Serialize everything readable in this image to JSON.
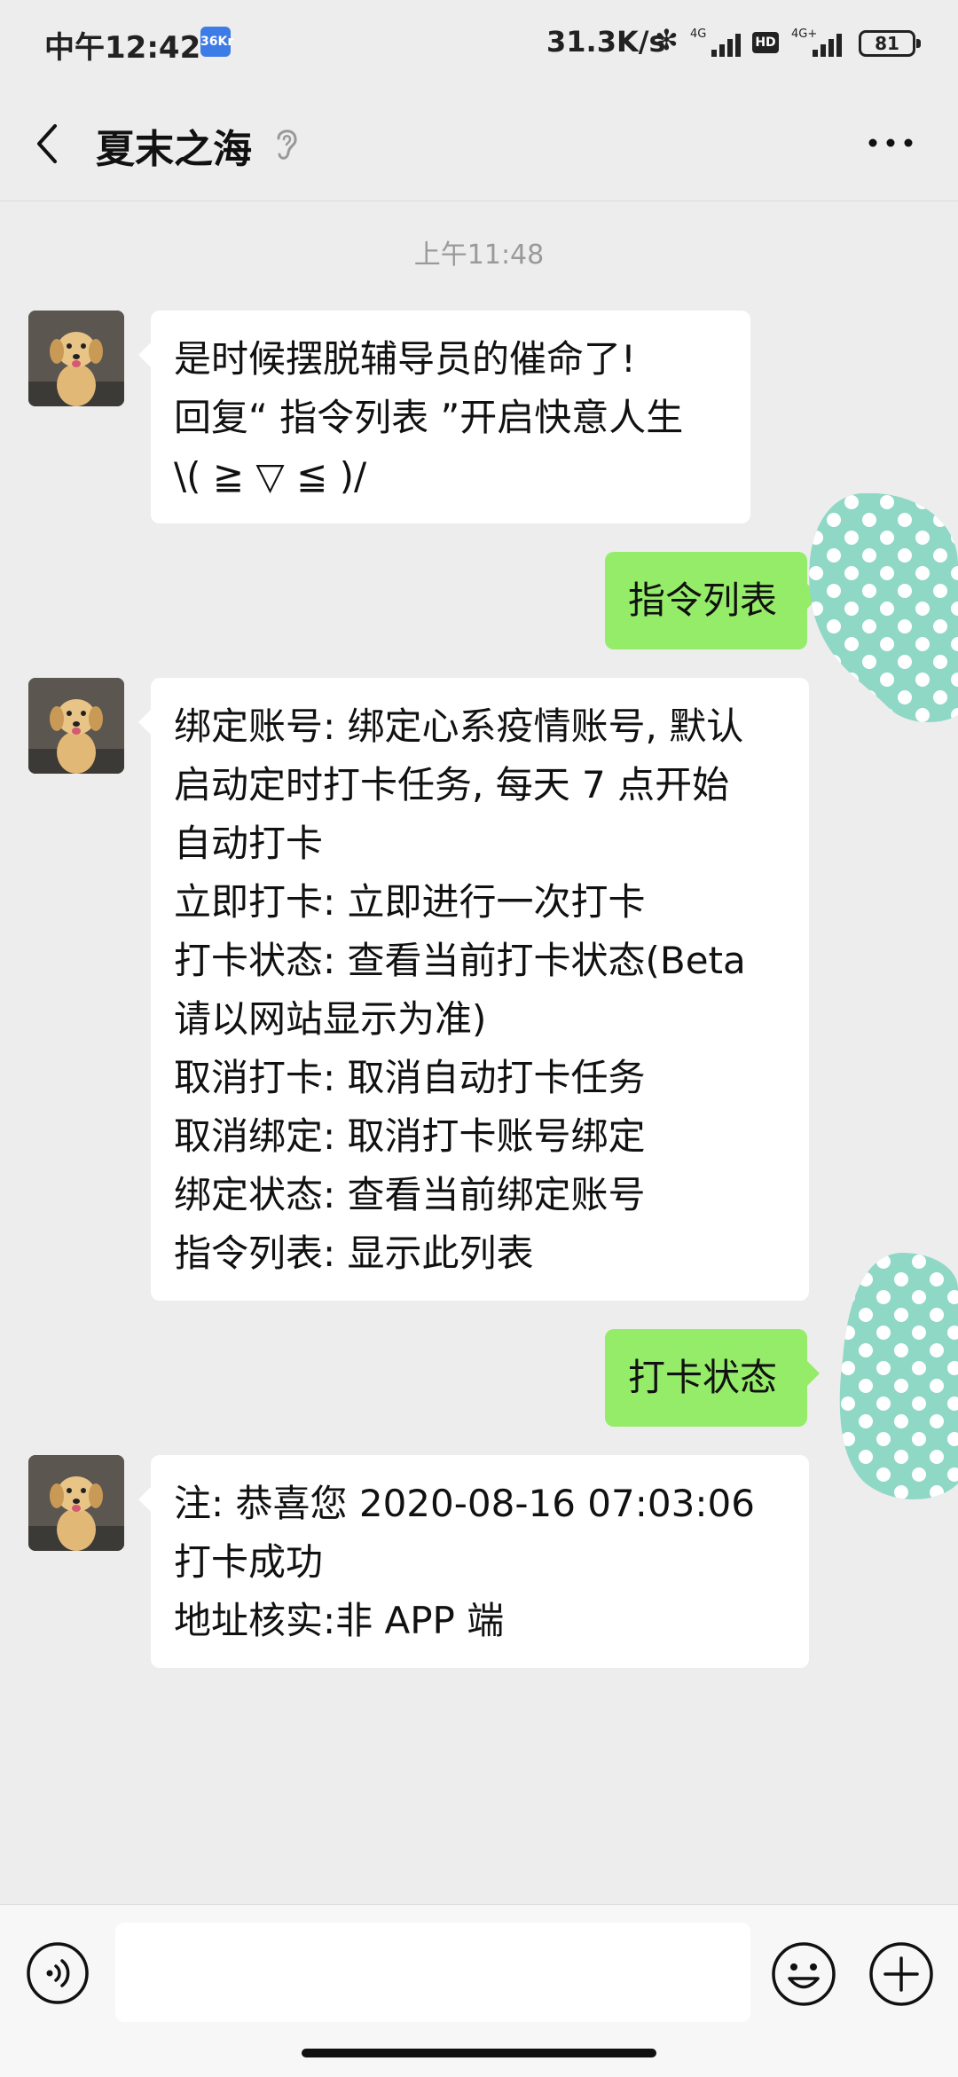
{
  "status_bar": {
    "time": "中午12:42",
    "app_badge": "36Kr",
    "net_speed": "31.3K/s",
    "bluetooth": "✻",
    "signal1_label": "4G",
    "hd": "HD",
    "signal2_label": "4G+",
    "battery": "81"
  },
  "header": {
    "title": "夏末之海",
    "back_icon": "chevron-left-icon",
    "ear_icon": "ear-icon",
    "more_icon": "more-dots-icon"
  },
  "chat": {
    "timestamp": "上午11:48",
    "messages": [
      {
        "side": "left",
        "lines": [
          "是时候摆脱辅导员的催命了!",
          "回复“ 指令列表 ”开启快意人生",
          "\\( ≧ ▽ ≦ )/"
        ]
      },
      {
        "side": "right",
        "lines": [
          "指令列表"
        ]
      },
      {
        "side": "left",
        "lines": [
          "绑定账号: 绑定心系疫情账号, 默认",
          "启动定时打卡任务, 每天 7 点开始",
          "自动打卡",
          "立即打卡: 立即进行一次打卡",
          "打卡状态: 查看当前打卡状态(Beta",
          "请以网站显示为准)",
          "取消打卡: 取消自动打卡任务",
          "取消绑定: 取消打卡账号绑定",
          "绑定状态: 查看当前绑定账号",
          "指令列表: 显示此列表"
        ]
      },
      {
        "side": "right",
        "lines": [
          "打卡状态"
        ]
      },
      {
        "side": "left",
        "lines": [
          "注: 恭喜您 2020-08-16 07:03:06",
          "打卡成功",
          "地址核实:非 APP 端"
        ]
      }
    ]
  },
  "input_bar": {
    "voice_icon": "voice-icon",
    "input_value": "",
    "emoji_icon": "emoji-icon",
    "plus_icon": "plus-icon"
  },
  "colors": {
    "background": "#ededed",
    "bubble_self": "#95ec69",
    "bubble_other": "#ffffff",
    "dot_avatar": "#8fd8c6"
  }
}
